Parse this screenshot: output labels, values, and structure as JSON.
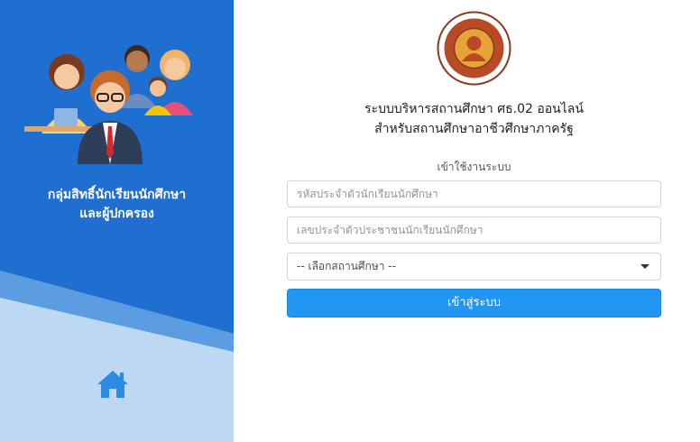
{
  "left_panel": {
    "title_line1": "กลุ่มสิทธิ์นักเรียนนักศึกษา",
    "title_line2": "และผู้ปกครอง",
    "home_icon": "home-icon",
    "hero_icon": "family-illustration",
    "colors": {
      "primary": "#1f6fd0",
      "light": "#bdd8f3",
      "stripe": "#5b9de0"
    }
  },
  "header": {
    "emblem_icon": "vocational-education-emblem",
    "title_line1": "ระบบบริหารสถานศึกษา ศธ.02 ออนไลน์",
    "title_line2": "สำหรับสถานศึกษาอาชีวศึกษาภาครัฐ"
  },
  "login": {
    "label": "เข้าใช้งานระบบ",
    "student_id_placeholder": "รหัสประจำตัวนักเรียนนักศึกษา",
    "citizen_id_placeholder": "เลขประจำตัวประชาชนนักเรียนนักศึกษา",
    "institution_select": "-- เลือกสถานศึกษา --",
    "submit_label": "เข้าสู่ระบบ",
    "button_color": "#2196f3"
  }
}
